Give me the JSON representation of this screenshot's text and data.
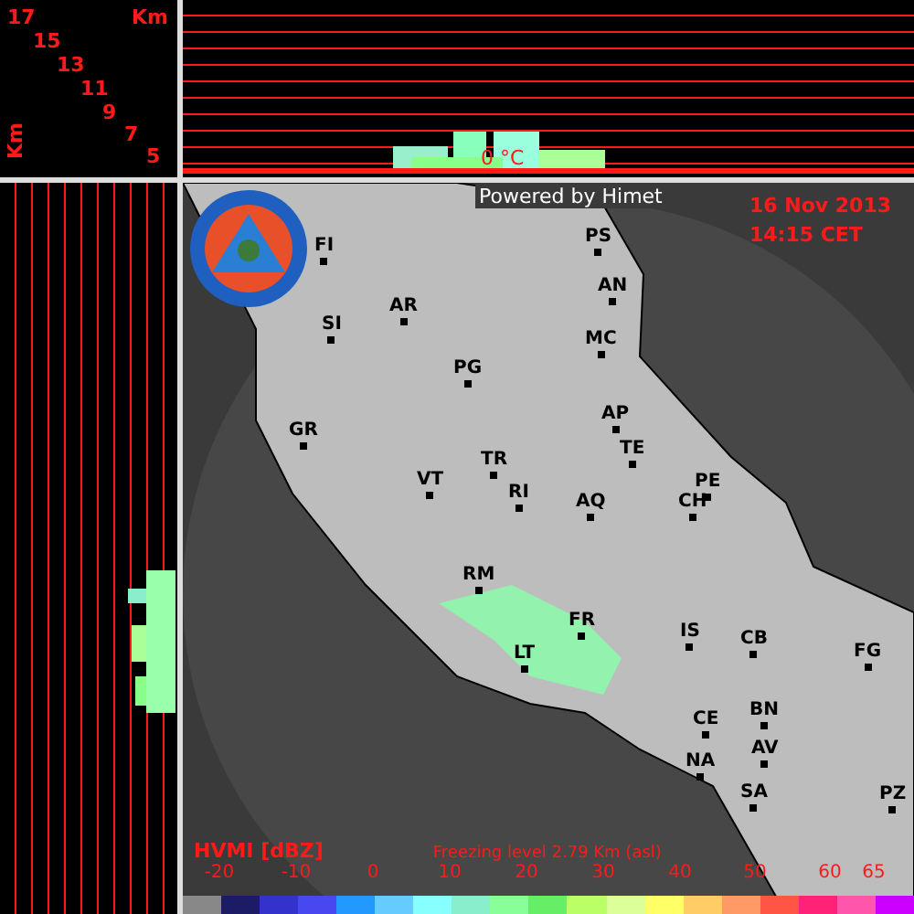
{
  "height_axis": {
    "unit": "Km",
    "vertical_label": "Km",
    "ticks": [
      "17",
      "15",
      "13",
      "11",
      "9",
      "7",
      "5"
    ]
  },
  "profile": {
    "freezing_mark": "0 °C"
  },
  "credit": "Powered by Himet",
  "date": "16 Nov 2013",
  "time": "14:15 CET",
  "cities": [
    "FI",
    "SI",
    "AR",
    "PS",
    "AN",
    "MC",
    "PG",
    "GR",
    "TR",
    "VT",
    "RI",
    "AP",
    "TE",
    "PE",
    "CH",
    "AQ",
    "RM",
    "FR",
    "LT",
    "IS",
    "CB",
    "FG",
    "CE",
    "BN",
    "AV",
    "NA",
    "SA",
    "PZ"
  ],
  "legend": {
    "title": "HVMI [dBZ]",
    "freezing_level": "Freezing level  2.79 Km (asl)",
    "ticks": [
      "-20",
      "-10",
      "0",
      "10",
      "20",
      "30",
      "40",
      "50",
      "60",
      "65"
    ],
    "colors": [
      {
        "color": "#888888"
      },
      {
        "color": "#1c1c66"
      },
      {
        "color": "#3333cc"
      },
      {
        "color": "#4848f0"
      },
      {
        "color": "#2299ff"
      },
      {
        "color": "#66ccff"
      },
      {
        "color": "#88ffff"
      },
      {
        "color": "#88eecc"
      },
      {
        "color": "#88ff99"
      },
      {
        "color": "#66ee66"
      },
      {
        "color": "#bbff66"
      },
      {
        "color": "#ddff99"
      },
      {
        "color": "#ffff66"
      },
      {
        "color": "#ffcc66"
      },
      {
        "color": "#ff9966"
      },
      {
        "color": "#ff5544"
      },
      {
        "color": "#ff2277"
      },
      {
        "color": "#ff55aa"
      },
      {
        "color": "#cc00ff"
      }
    ]
  }
}
